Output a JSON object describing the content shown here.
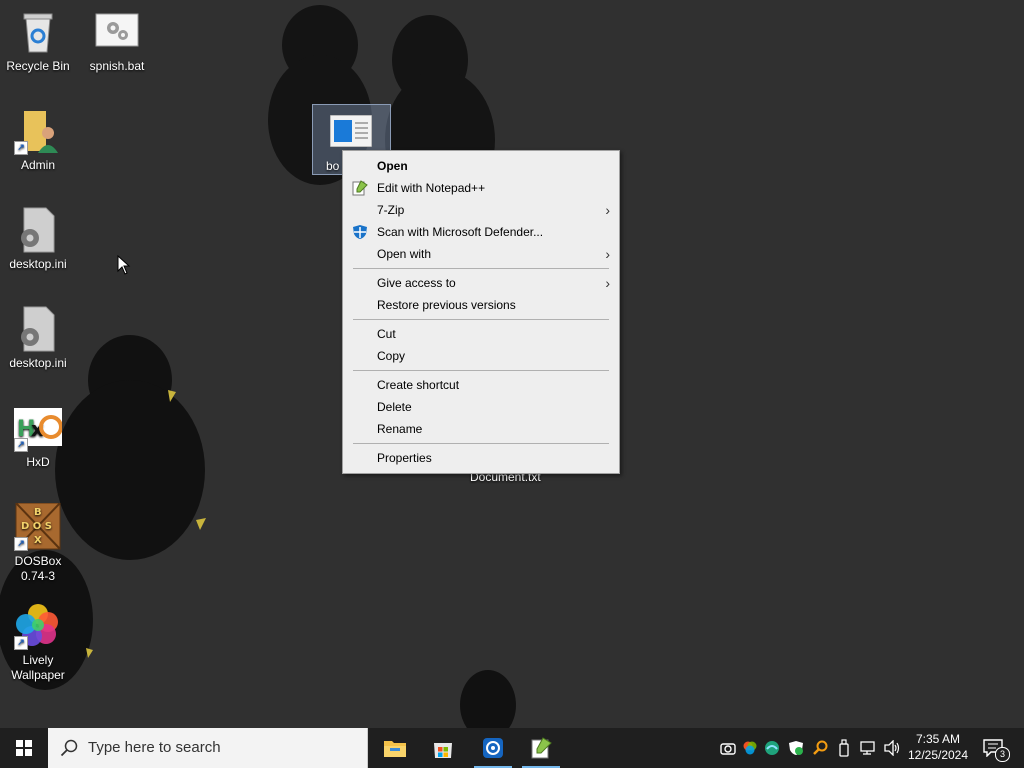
{
  "desktop": {
    "icons": [
      {
        "name": "Recycle Bin",
        "icon": "recycle-bin-icon"
      },
      {
        "name": "spnish.bat",
        "icon": "batch-file-icon"
      },
      {
        "name": "Admin",
        "icon": "user-folder-icon"
      },
      {
        "name": "desktop.ini",
        "icon": "settings-file-icon"
      },
      {
        "name": "desktop.ini",
        "icon": "settings-file-icon"
      },
      {
        "name": "HxD",
        "icon": "hxd-icon"
      },
      {
        "name": "DOSBox 0.74-3",
        "icon": "dosbox-icon"
      },
      {
        "name": "Lively Wallpaper",
        "icon": "lively-wallpaper-icon"
      }
    ],
    "selected_icon_label": "bo",
    "document_label": "Document.txt"
  },
  "context_menu": {
    "items": [
      {
        "label": "Open",
        "bold": true
      },
      {
        "label": "Edit with Notepad++",
        "icon": "notepadpp-icon"
      },
      {
        "label": "7-Zip",
        "submenu": true
      },
      {
        "label": "Scan with Microsoft Defender...",
        "icon": "defender-icon"
      },
      {
        "label": "Open with",
        "submenu": true
      },
      {
        "label": "Give access to",
        "submenu": true
      },
      {
        "label": "Restore previous versions"
      },
      {
        "label": "Cut"
      },
      {
        "label": "Copy"
      },
      {
        "label": "Create shortcut"
      },
      {
        "label": "Delete"
      },
      {
        "label": "Rename"
      },
      {
        "label": "Properties"
      }
    ]
  },
  "taskbar": {
    "search_placeholder": "Type here to search",
    "apps": [
      "file-explorer-icon",
      "microsoft-store-icon",
      "app-icon",
      "notepadpp-icon"
    ],
    "clock_time": "7:35 AM",
    "clock_date": "12/25/2024",
    "notification_count": "3"
  },
  "colors": {
    "accent": "#76b9ed",
    "taskbar": "#1f1f1f",
    "menu_bg": "#eeeeee"
  }
}
